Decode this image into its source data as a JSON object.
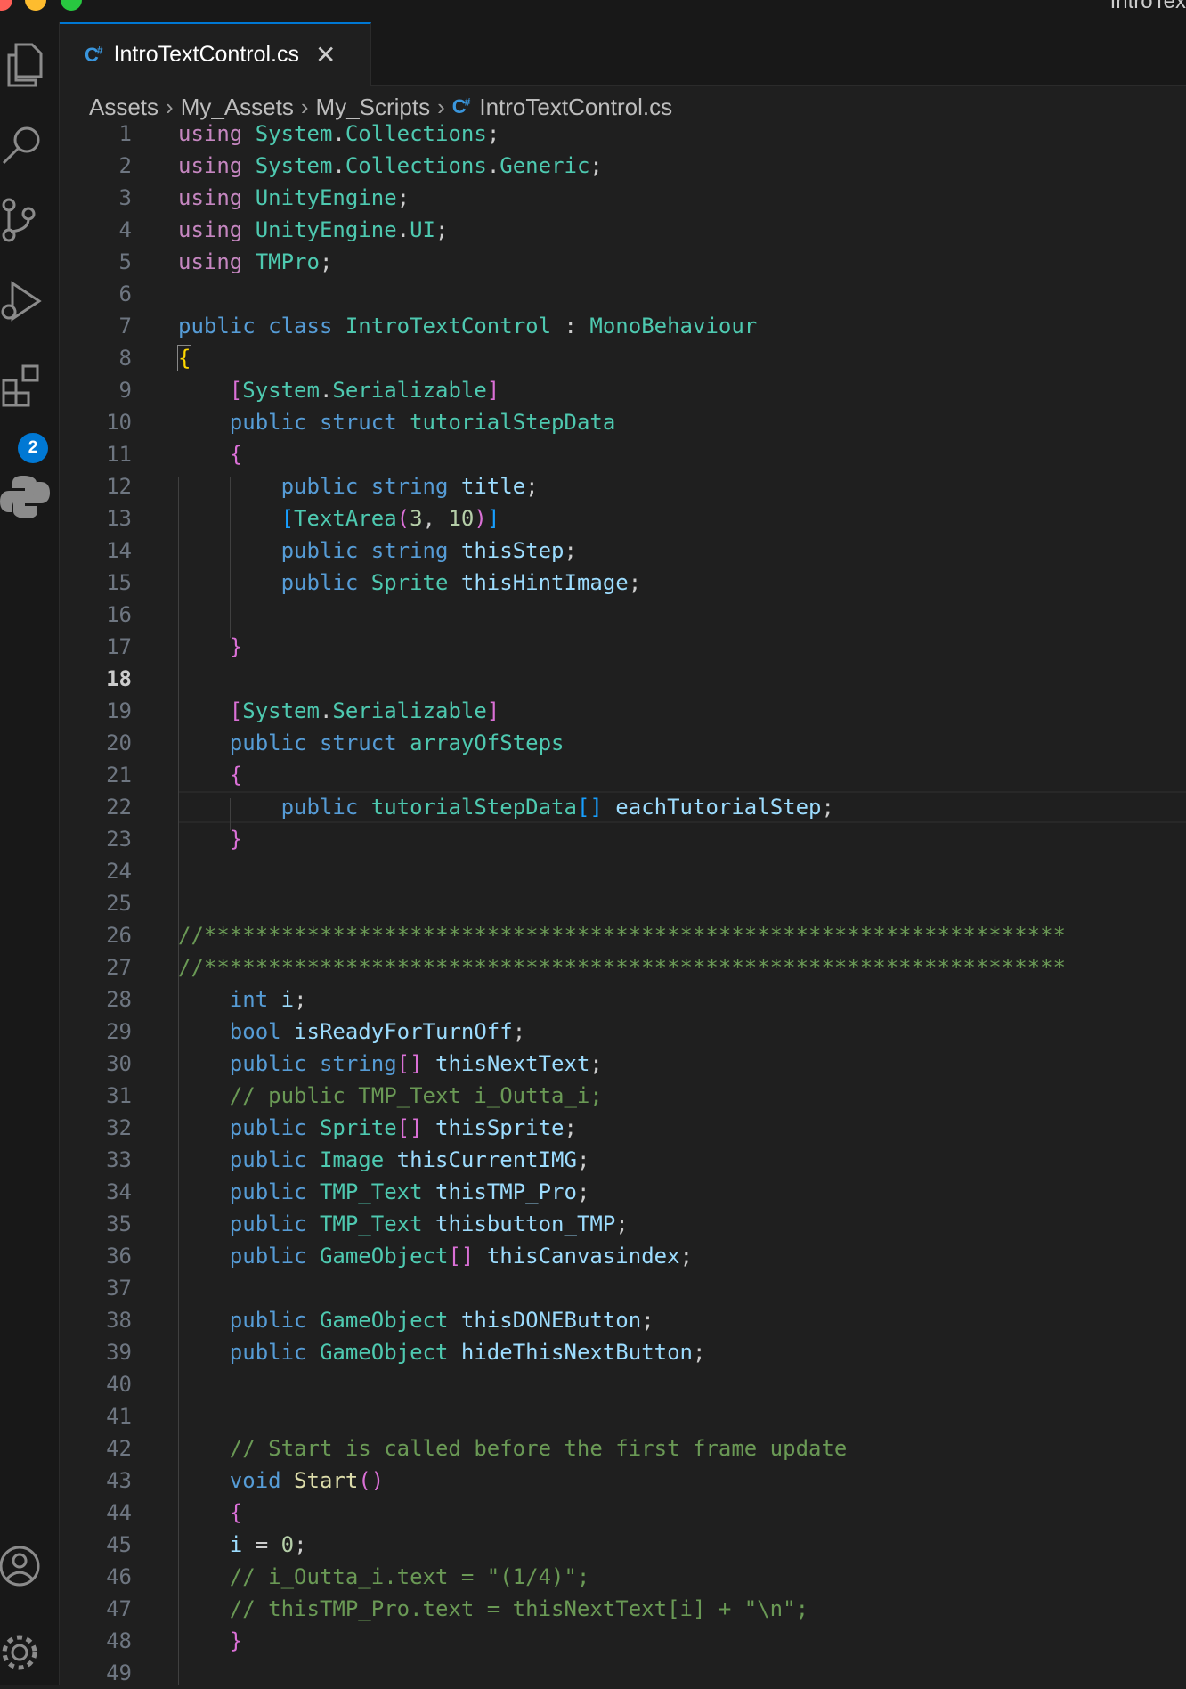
{
  "window": {
    "title": "IntroTex"
  },
  "activity_bar": {
    "icons": [
      "explorer-icon",
      "search-icon",
      "source-control-icon",
      "run-debug-icon",
      "extensions-icon",
      "python-icon",
      "account-icon",
      "settings-gear-icon"
    ],
    "extensions_badge": "2"
  },
  "tab": {
    "label": "IntroTextControl.cs",
    "icon_text": "C#",
    "close_glyph": "✕"
  },
  "breadcrumb": [
    "Assets",
    "My_Assets",
    "My_Scripts",
    "IntroTextControl.cs"
  ],
  "editor": {
    "active_line": 18,
    "line_numbers": [
      "1",
      "2",
      "3",
      "4",
      "5",
      "6",
      "7",
      "8",
      "9",
      "10",
      "11",
      "12",
      "13",
      "14",
      "15",
      "16",
      "17",
      "18",
      "19",
      "20",
      "21",
      "22",
      "23",
      "24",
      "25",
      "26",
      "27",
      "28",
      "29",
      "30",
      "31",
      "32",
      "33",
      "34",
      "35",
      "36",
      "37",
      "38",
      "39",
      "40",
      "41",
      "42",
      "43",
      "44",
      "45",
      "46",
      "47",
      "48",
      "49"
    ],
    "lines": [
      [
        [
          "kw",
          "using"
        ],
        [
          "pl",
          " "
        ],
        [
          "ty",
          "System"
        ],
        [
          "pl",
          "."
        ],
        [
          "ty",
          "Collections"
        ],
        [
          "pl",
          ";"
        ]
      ],
      [
        [
          "kw",
          "using"
        ],
        [
          "pl",
          " "
        ],
        [
          "ty",
          "System"
        ],
        [
          "pl",
          "."
        ],
        [
          "ty",
          "Collections"
        ],
        [
          "pl",
          "."
        ],
        [
          "ty",
          "Generic"
        ],
        [
          "pl",
          ";"
        ]
      ],
      [
        [
          "kw",
          "using"
        ],
        [
          "pl",
          " "
        ],
        [
          "ty",
          "UnityEngine"
        ],
        [
          "pl",
          ";"
        ]
      ],
      [
        [
          "kw",
          "using"
        ],
        [
          "pl",
          " "
        ],
        [
          "ty",
          "UnityEngine"
        ],
        [
          "pl",
          "."
        ],
        [
          "ty",
          "UI"
        ],
        [
          "pl",
          ";"
        ]
      ],
      [
        [
          "kw",
          "using"
        ],
        [
          "pl",
          " "
        ],
        [
          "ty",
          "TMPro"
        ],
        [
          "pl",
          ";"
        ]
      ],
      [],
      [
        [
          "kb",
          "public"
        ],
        [
          "pl",
          " "
        ],
        [
          "kb",
          "class"
        ],
        [
          "pl",
          " "
        ],
        [
          "ty",
          "IntroTextControl"
        ],
        [
          "pl",
          " : "
        ],
        [
          "ty",
          "MonoBehaviour"
        ]
      ],
      [
        [
          "b1box",
          "{"
        ]
      ],
      [
        [
          "pl",
          "    "
        ],
        [
          "b2",
          "["
        ],
        [
          "ty",
          "System"
        ],
        [
          "pl",
          "."
        ],
        [
          "ty",
          "Serializable"
        ],
        [
          "b2",
          "]"
        ]
      ],
      [
        [
          "pl",
          "    "
        ],
        [
          "kb",
          "public"
        ],
        [
          "pl",
          " "
        ],
        [
          "kb",
          "struct"
        ],
        [
          "pl",
          " "
        ],
        [
          "ty",
          "tutorialStepData"
        ]
      ],
      [
        [
          "pl",
          "    "
        ],
        [
          "b2",
          "{"
        ]
      ],
      [
        [
          "pl",
          "        "
        ],
        [
          "kb",
          "public"
        ],
        [
          "pl",
          " "
        ],
        [
          "kb",
          "string"
        ],
        [
          "pl",
          " "
        ],
        [
          "id",
          "title"
        ],
        [
          "pl",
          ";"
        ]
      ],
      [
        [
          "pl",
          "        "
        ],
        [
          "b3",
          "["
        ],
        [
          "ty",
          "TextArea"
        ],
        [
          "b2",
          "("
        ],
        [
          "num",
          "3"
        ],
        [
          "pl",
          ", "
        ],
        [
          "num",
          "10"
        ],
        [
          "b2",
          ")"
        ],
        [
          "b3",
          "]"
        ]
      ],
      [
        [
          "pl",
          "        "
        ],
        [
          "kb",
          "public"
        ],
        [
          "pl",
          " "
        ],
        [
          "kb",
          "string"
        ],
        [
          "pl",
          " "
        ],
        [
          "id",
          "thisStep"
        ],
        [
          "pl",
          ";"
        ]
      ],
      [
        [
          "pl",
          "        "
        ],
        [
          "kb",
          "public"
        ],
        [
          "pl",
          " "
        ],
        [
          "ty",
          "Sprite"
        ],
        [
          "pl",
          " "
        ],
        [
          "id",
          "thisHintImage"
        ],
        [
          "pl",
          ";"
        ]
      ],
      [],
      [
        [
          "pl",
          "    "
        ],
        [
          "b2",
          "}"
        ]
      ],
      [],
      [
        [
          "pl",
          "    "
        ],
        [
          "b2",
          "["
        ],
        [
          "ty",
          "System"
        ],
        [
          "pl",
          "."
        ],
        [
          "ty",
          "Serializable"
        ],
        [
          "b2",
          "]"
        ]
      ],
      [
        [
          "pl",
          "    "
        ],
        [
          "kb",
          "public"
        ],
        [
          "pl",
          " "
        ],
        [
          "kb",
          "struct"
        ],
        [
          "pl",
          " "
        ],
        [
          "ty",
          "arrayOfSteps"
        ]
      ],
      [
        [
          "pl",
          "    "
        ],
        [
          "b2",
          "{"
        ]
      ],
      [
        [
          "pl",
          "        "
        ],
        [
          "kb",
          "public"
        ],
        [
          "pl",
          " "
        ],
        [
          "ty",
          "tutorialStepData"
        ],
        [
          "b3",
          "[]"
        ],
        [
          "pl",
          " "
        ],
        [
          "id",
          "eachTutorialStep"
        ],
        [
          "pl",
          ";"
        ]
      ],
      [
        [
          "pl",
          "    "
        ],
        [
          "b2",
          "}"
        ]
      ],
      [],
      [],
      [
        [
          "com",
          "//*******************************************************************"
        ]
      ],
      [
        [
          "com",
          "//*******************************************************************"
        ]
      ],
      [
        [
          "pl",
          "    "
        ],
        [
          "kb",
          "int"
        ],
        [
          "pl",
          " "
        ],
        [
          "id",
          "i"
        ],
        [
          "pl",
          ";"
        ]
      ],
      [
        [
          "pl",
          "    "
        ],
        [
          "kb",
          "bool"
        ],
        [
          "pl",
          " "
        ],
        [
          "id",
          "isReadyForTurnOff"
        ],
        [
          "pl",
          ";"
        ]
      ],
      [
        [
          "pl",
          "    "
        ],
        [
          "kb",
          "public"
        ],
        [
          "pl",
          " "
        ],
        [
          "kb",
          "string"
        ],
        [
          "b2",
          "[]"
        ],
        [
          "pl",
          " "
        ],
        [
          "id",
          "thisNextText"
        ],
        [
          "pl",
          ";"
        ]
      ],
      [
        [
          "pl",
          "    "
        ],
        [
          "com",
          "// public TMP_Text i_Outta_i;"
        ]
      ],
      [
        [
          "pl",
          "    "
        ],
        [
          "kb",
          "public"
        ],
        [
          "pl",
          " "
        ],
        [
          "ty",
          "Sprite"
        ],
        [
          "b2",
          "[]"
        ],
        [
          "pl",
          " "
        ],
        [
          "id",
          "thisSprite"
        ],
        [
          "pl",
          ";"
        ]
      ],
      [
        [
          "pl",
          "    "
        ],
        [
          "kb",
          "public"
        ],
        [
          "pl",
          " "
        ],
        [
          "ty",
          "Image"
        ],
        [
          "pl",
          " "
        ],
        [
          "id",
          "thisCurrentIMG"
        ],
        [
          "pl",
          ";"
        ]
      ],
      [
        [
          "pl",
          "    "
        ],
        [
          "kb",
          "public"
        ],
        [
          "pl",
          " "
        ],
        [
          "ty",
          "TMP_Text"
        ],
        [
          "pl",
          " "
        ],
        [
          "id",
          "thisTMP_Pro"
        ],
        [
          "pl",
          ";"
        ]
      ],
      [
        [
          "pl",
          "    "
        ],
        [
          "kb",
          "public"
        ],
        [
          "pl",
          " "
        ],
        [
          "ty",
          "TMP_Text"
        ],
        [
          "pl",
          " "
        ],
        [
          "id",
          "thisbutton_TMP"
        ],
        [
          "pl",
          ";"
        ]
      ],
      [
        [
          "pl",
          "    "
        ],
        [
          "kb",
          "public"
        ],
        [
          "pl",
          " "
        ],
        [
          "ty",
          "GameObject"
        ],
        [
          "b2",
          "[]"
        ],
        [
          "pl",
          " "
        ],
        [
          "id",
          "thisCanvasindex"
        ],
        [
          "pl",
          ";"
        ]
      ],
      [],
      [
        [
          "pl",
          "    "
        ],
        [
          "kb",
          "public"
        ],
        [
          "pl",
          " "
        ],
        [
          "ty",
          "GameObject"
        ],
        [
          "pl",
          " "
        ],
        [
          "id",
          "thisDONEButton"
        ],
        [
          "pl",
          ";"
        ]
      ],
      [
        [
          "pl",
          "    "
        ],
        [
          "kb",
          "public"
        ],
        [
          "pl",
          " "
        ],
        [
          "ty",
          "GameObject"
        ],
        [
          "pl",
          " "
        ],
        [
          "id",
          "hideThisNextButton"
        ],
        [
          "pl",
          ";"
        ]
      ],
      [],
      [],
      [
        [
          "pl",
          "    "
        ],
        [
          "com",
          "// Start is called before the first frame update"
        ]
      ],
      [
        [
          "pl",
          "    "
        ],
        [
          "kb",
          "void"
        ],
        [
          "pl",
          " "
        ],
        [
          "fn",
          "Start"
        ],
        [
          "b2",
          "()"
        ]
      ],
      [
        [
          "pl",
          "    "
        ],
        [
          "b2",
          "{"
        ]
      ],
      [
        [
          "pl",
          "    "
        ],
        [
          "id",
          "i"
        ],
        [
          "pl",
          " = "
        ],
        [
          "num",
          "0"
        ],
        [
          "pl",
          ";"
        ]
      ],
      [
        [
          "pl",
          "    "
        ],
        [
          "com",
          "// i_Outta_i.text = \"(1/4)\";"
        ]
      ],
      [
        [
          "pl",
          "    "
        ],
        [
          "com",
          "// thisTMP_Pro.text = thisNextText[i] + \"\\n\";"
        ]
      ],
      [
        [
          "pl",
          "    "
        ],
        [
          "b2",
          "}"
        ]
      ],
      []
    ]
  }
}
